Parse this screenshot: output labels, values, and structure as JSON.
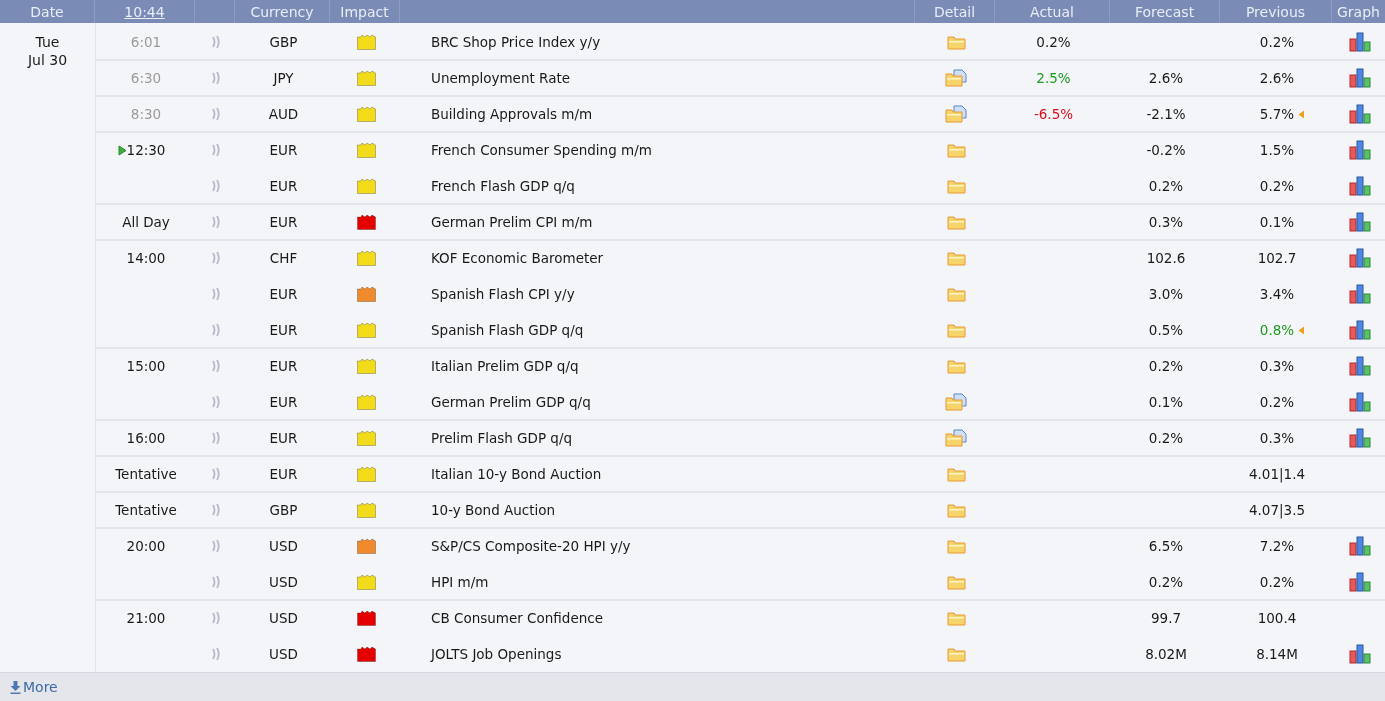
{
  "header": {
    "date": "Date",
    "time": "10:44",
    "currency": "Currency",
    "impact": "Impact",
    "detail": "Detail",
    "actual": "Actual",
    "forecast": "Forecast",
    "previous": "Previous",
    "graph": "Graph"
  },
  "day": {
    "weekday": "Tue",
    "date": "Jul 30"
  },
  "rows": [
    {
      "time": "6:01",
      "past": true,
      "current": false,
      "currency": "GBP",
      "color": "#f2dc1a",
      "event": "BRC Shop Price Index y/y",
      "has_document": false,
      "actual": "0.2%",
      "actual_better": false,
      "actual_worse": false,
      "previous": "0.2%",
      "previous_better": false,
      "revised": false,
      "graph": true
    },
    {
      "time": "6:30",
      "past": true,
      "current": false,
      "currency": "JPY",
      "color": "#f2dc1a",
      "event": "Unemployment Rate",
      "has_document": true,
      "actual": "2.5%",
      "actual_better": true,
      "actual_worse": false,
      "forecast": "2.6%",
      "previous": "2.6%",
      "previous_better": false,
      "revised": false,
      "graph": true
    },
    {
      "time": "8:30",
      "past": true,
      "current": false,
      "currency": "AUD",
      "color": "#f2dc1a",
      "event": "Building Approvals m/m",
      "has_document": true,
      "actual": "-6.5%",
      "actual_better": false,
      "actual_worse": true,
      "forecast": "-2.1%",
      "previous": "5.7%",
      "previous_better": false,
      "revised": true,
      "graph": true
    },
    {
      "time": "12:30",
      "past": false,
      "current": true,
      "currency": "EUR",
      "color": "#f2dc1a",
      "event": "French Consumer Spending m/m",
      "has_document": false,
      "forecast": "-0.2%",
      "previous": "1.5%",
      "previous_better": false,
      "revised": false,
      "graph": true
    },
    {
      "current": false,
      "currency": "EUR",
      "color": "#f2dc1a",
      "event": "French Flash GDP q/q",
      "has_document": false,
      "forecast": "0.2%",
      "previous": "0.2%",
      "previous_better": false,
      "revised": false,
      "graph": true
    },
    {
      "time": "All Day",
      "past": false,
      "current": false,
      "currency": "EUR",
      "color": "#e40000",
      "event": "German Prelim CPI m/m",
      "has_document": false,
      "forecast": "0.3%",
      "previous": "0.1%",
      "previous_better": false,
      "revised": false,
      "graph": true
    },
    {
      "time": "14:00",
      "past": false,
      "current": false,
      "currency": "CHF",
      "color": "#f2dc1a",
      "event": "KOF Economic Barometer",
      "has_document": false,
      "forecast": "102.6",
      "previous": "102.7",
      "previous_better": false,
      "revised": false,
      "graph": true
    },
    {
      "current": false,
      "currency": "EUR",
      "color": "#f08a2c",
      "event": "Spanish Flash CPI y/y",
      "has_document": false,
      "forecast": "3.0%",
      "previous": "3.4%",
      "previous_better": false,
      "revised": false,
      "graph": true
    },
    {
      "current": false,
      "currency": "EUR",
      "color": "#f2dc1a",
      "event": "Spanish Flash GDP q/q",
      "has_document": false,
      "forecast": "0.5%",
      "previous": "0.8%",
      "previous_better": true,
      "revised": true,
      "graph": true
    },
    {
      "time": "15:00",
      "past": false,
      "current": false,
      "currency": "EUR",
      "color": "#f2dc1a",
      "event": "Italian Prelim GDP q/q",
      "has_document": false,
      "forecast": "0.2%",
      "previous": "0.3%",
      "previous_better": false,
      "revised": false,
      "graph": true
    },
    {
      "current": false,
      "currency": "EUR",
      "color": "#f2dc1a",
      "event": "German Prelim GDP q/q",
      "has_document": true,
      "forecast": "0.1%",
      "previous": "0.2%",
      "previous_better": false,
      "revised": false,
      "graph": true
    },
    {
      "time": "16:00",
      "past": false,
      "current": false,
      "currency": "EUR",
      "color": "#f2dc1a",
      "event": "Prelim Flash GDP q/q",
      "has_document": true,
      "forecast": "0.2%",
      "previous": "0.3%",
      "previous_better": false,
      "revised": false,
      "graph": true
    },
    {
      "time": "Tentative",
      "past": false,
      "current": false,
      "currency": "EUR",
      "color": "#f2dc1a",
      "event": "Italian 10-y Bond Auction",
      "has_document": false,
      "previous": "4.01|1.4",
      "previous_better": false,
      "revised": false,
      "graph": false
    },
    {
      "time": "Tentative",
      "past": false,
      "current": false,
      "currency": "GBP",
      "color": "#f2dc1a",
      "event": "10-y Bond Auction",
      "has_document": false,
      "previous": "4.07|3.5",
      "previous_better": false,
      "revised": false,
      "graph": false
    },
    {
      "time": "20:00",
      "past": false,
      "current": false,
      "currency": "USD",
      "color": "#f08a2c",
      "event": "S&P/CS Composite-20 HPI y/y",
      "has_document": false,
      "forecast": "6.5%",
      "previous": "7.2%",
      "previous_better": false,
      "revised": false,
      "graph": true
    },
    {
      "current": false,
      "currency": "USD",
      "color": "#f2dc1a",
      "event": "HPI m/m",
      "has_document": false,
      "forecast": "0.2%",
      "previous": "0.2%",
      "previous_better": false,
      "revised": false,
      "graph": true
    },
    {
      "time": "21:00",
      "past": false,
      "current": false,
      "currency": "USD",
      "color": "#e40000",
      "event": "CB Consumer Confidence",
      "has_document": false,
      "forecast": "99.7",
      "previous": "100.4",
      "previous_better": false,
      "revised": false,
      "graph": false
    },
    {
      "current": false,
      "currency": "USD",
      "color": "#e40000",
      "event": "JOLTS Job Openings",
      "has_document": false,
      "forecast": "8.02M",
      "previous": "8.14M",
      "previous_better": false,
      "revised": false,
      "graph": true
    }
  ],
  "footer": {
    "more": "More"
  }
}
